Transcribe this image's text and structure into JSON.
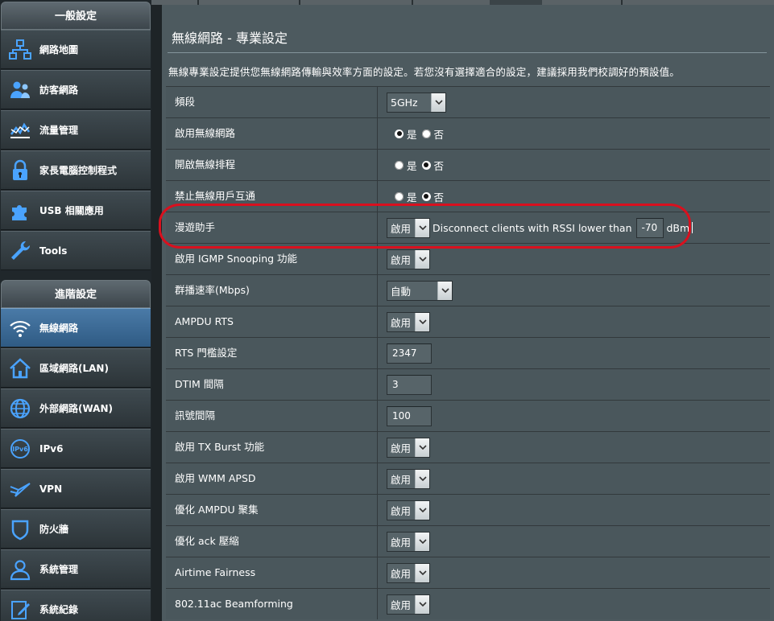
{
  "sidebar": {
    "general_header": "一般設定",
    "general_items": [
      {
        "label": "網路地圖",
        "icon": "network-map-icon"
      },
      {
        "label": "訪客網路",
        "icon": "guest-network-icon"
      },
      {
        "label": "流量管理",
        "icon": "traffic-manager-icon"
      },
      {
        "label": "家長電腦控制程式",
        "icon": "parental-control-icon"
      },
      {
        "label": "USB 相關應用",
        "icon": "usb-app-icon"
      },
      {
        "label": "Tools",
        "icon": "tools-icon"
      }
    ],
    "advanced_header": "進階設定",
    "advanced_items": [
      {
        "label": "無線網路",
        "icon": "wireless-icon",
        "active": true
      },
      {
        "label": "區域網路(LAN)",
        "icon": "lan-icon"
      },
      {
        "label": "外部網路(WAN)",
        "icon": "wan-icon"
      },
      {
        "label": "IPv6",
        "icon": "ipv6-icon"
      },
      {
        "label": "VPN",
        "icon": "vpn-icon"
      },
      {
        "label": "防火牆",
        "icon": "firewall-icon"
      },
      {
        "label": "系統管理",
        "icon": "administration-icon"
      },
      {
        "label": "系統紀錄",
        "icon": "system-log-icon"
      }
    ]
  },
  "main": {
    "title": "無線網路 - 專業設定",
    "description": "無線專業設定提供您無線網路傳輸與效率方面的設定。若您沒有選擇適合的設定，建議採用我們校調好的預設值。",
    "yes_label": "是",
    "no_label": "否",
    "rows": {
      "band": {
        "label": "頻段",
        "value": "5GHz"
      },
      "enable_radio": {
        "label": "啟用無線網路",
        "selected": "yes"
      },
      "schedule": {
        "label": "開啟無線排程",
        "selected": "no"
      },
      "isolation": {
        "label": "禁止無線用戶互通",
        "selected": "no"
      },
      "roaming": {
        "label": "漫遊助手",
        "value": "啟用",
        "text_before": "Disconnect clients with RSSI lower than",
        "rssi": "-70",
        "unit": "dBm"
      },
      "igmp": {
        "label": "啟用 IGMP Snooping 功能",
        "value": "啟用"
      },
      "multicast": {
        "label": "群播速率(Mbps)",
        "value": "自動"
      },
      "ampdu_rts": {
        "label": "AMPDU RTS",
        "value": "啟用"
      },
      "rts": {
        "label": "RTS 門檻設定",
        "value": "2347"
      },
      "dtim": {
        "label": "DTIM 間隔",
        "value": "3"
      },
      "beacon": {
        "label": "訊號間隔",
        "value": "100"
      },
      "tx_burst": {
        "label": "啟用 TX Burst 功能",
        "value": "啟用"
      },
      "wmm_apsd": {
        "label": "啟用 WMM APSD",
        "value": "啟用"
      },
      "ampdu_agg": {
        "label": "優化 AMPDU 聚集",
        "value": "啟用"
      },
      "ack": {
        "label": "優化 ack 壓縮",
        "value": "啟用"
      },
      "airtime": {
        "label": "Airtime Fairness",
        "value": "啟用"
      },
      "beamforming": {
        "label": "802.11ac Beamforming",
        "value": "啟用"
      }
    }
  },
  "colors": {
    "accent_active": "#3e6d99",
    "highlight": "#d9101e",
    "panel": "#4d5a5f"
  }
}
